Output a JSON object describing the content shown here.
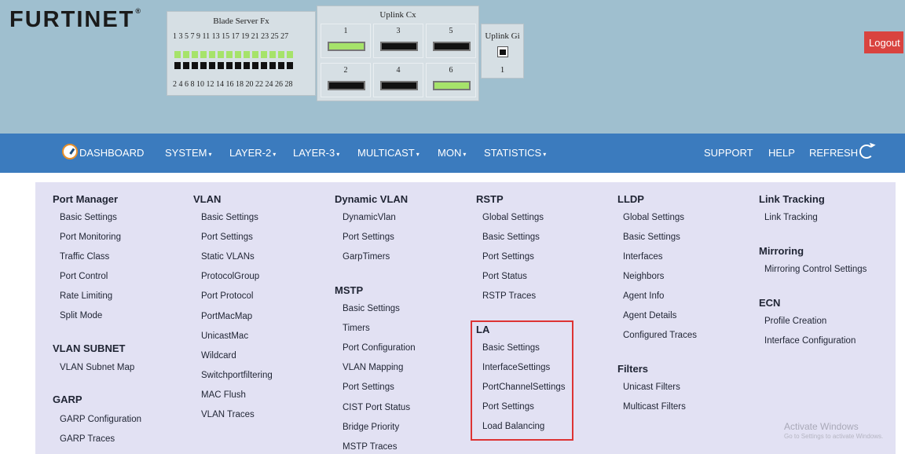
{
  "header": {
    "logo": "FURTINET",
    "blade": {
      "title": "Blade Server Fx",
      "odd_numbers": "1 3 5 7 9 11 13 15 17 19 21 23 25 27",
      "even_numbers": "2 4 6 8 10 12 14 16 18 20 22 24 26 28"
    },
    "uplink_cx": {
      "title": "Uplink Cx",
      "ports": [
        {
          "num": "1",
          "status": "up"
        },
        {
          "num": "3",
          "status": "down"
        },
        {
          "num": "5",
          "status": "down"
        },
        {
          "num": "2",
          "status": "down"
        },
        {
          "num": "4",
          "status": "down"
        },
        {
          "num": "6",
          "status": "up"
        }
      ]
    },
    "uplink_gi": {
      "title": "Uplink Gi",
      "port": "1"
    },
    "logout": "Logout"
  },
  "nav": {
    "dashboard": "DASHBOARD",
    "system": "SYSTEM",
    "layer2": "LAYER-2",
    "layer3": "LAYER-3",
    "multicast": "MULTICAST",
    "mon": "MON",
    "statistics": "STATISTICS",
    "support": "SUPPORT",
    "help": "HELP",
    "refresh": "REFRESH",
    "caret": "▾"
  },
  "menu": {
    "port_manager": {
      "title": "Port Manager",
      "items": [
        "Basic Settings",
        "Port Monitoring",
        "Traffic Class",
        "Port Control",
        "Rate Limiting",
        "Split Mode"
      ]
    },
    "vlan_subnet": {
      "title": "VLAN SUBNET",
      "items": [
        "VLAN Subnet Map"
      ]
    },
    "garp": {
      "title": "GARP",
      "items": [
        "GARP Configuration",
        "GARP Traces"
      ]
    },
    "vlan": {
      "title": "VLAN",
      "items": [
        "Basic Settings",
        "Port Settings",
        "Static VLANs",
        "ProtocolGroup",
        "Port Protocol",
        "PortMacMap",
        "UnicastMac",
        "Wildcard",
        "Switchportfiltering",
        "MAC Flush",
        "VLAN Traces"
      ]
    },
    "dynamic_vlan": {
      "title": "Dynamic VLAN",
      "items": [
        "DynamicVlan",
        "Port Settings",
        "GarpTimers"
      ]
    },
    "mstp": {
      "title": "MSTP",
      "items": [
        "Basic Settings",
        "Timers",
        "Port Configuration",
        "VLAN Mapping",
        "Port Settings",
        "CIST Port Status",
        "Bridge Priority",
        "MSTP Traces"
      ]
    },
    "rstp": {
      "title": "RSTP",
      "items": [
        "Global Settings",
        "Basic Settings",
        "Port Settings",
        "Port Status",
        "RSTP Traces"
      ]
    },
    "la": {
      "title": "LA",
      "items": [
        "Basic Settings",
        "InterfaceSettings",
        "PortChannelSettings",
        "Port Settings",
        "Load Balancing"
      ]
    },
    "lldp": {
      "title": "LLDP",
      "items": [
        "Global Settings",
        "Basic Settings",
        "Interfaces",
        "Neighbors",
        "Agent Info",
        "Agent Details",
        "Configured Traces"
      ]
    },
    "filters": {
      "title": "Filters",
      "items": [
        "Unicast Filters",
        "Multicast Filters"
      ]
    },
    "link_tracking": {
      "title": "Link Tracking",
      "items": [
        "Link Tracking"
      ]
    },
    "mirroring": {
      "title": "Mirroring",
      "items": [
        "Mirroring Control Settings"
      ]
    },
    "ecn": {
      "title": "ECN",
      "items": [
        "Profile Creation",
        "Interface Configuration"
      ]
    }
  },
  "watermark": {
    "line1": "Activate Windows",
    "line2": "Go to Settings to activate Windows."
  },
  "colors": {
    "port_up": "#a6e36a",
    "port_down": "#111111",
    "nav_bg": "#3b7bbe",
    "logout_bg": "#d9433f",
    "menu_bg": "#e2e1f3",
    "highlight": "#dd3333"
  }
}
